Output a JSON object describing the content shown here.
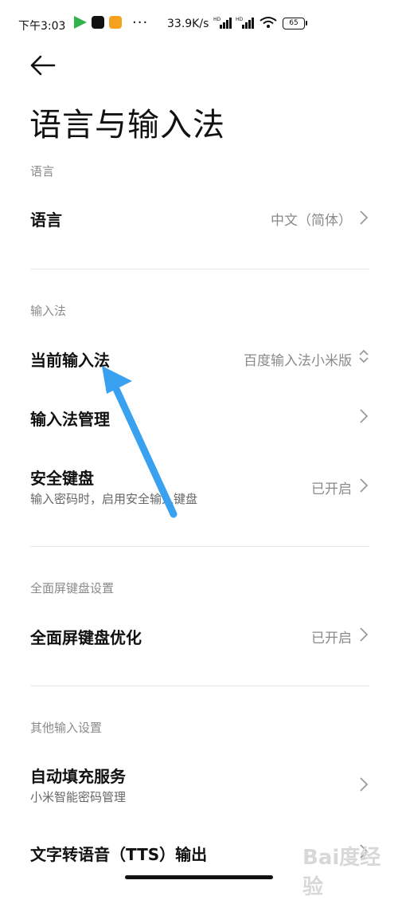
{
  "status_bar": {
    "time": "下午3:03",
    "more": "···",
    "net_speed": "33.9K/s",
    "battery": "65",
    "app_icon_colors": [
      "#2fb34a",
      "#111111",
      "#f4a11d"
    ]
  },
  "header": {
    "back_icon": "arrow-left-icon",
    "title": "语言与输入法"
  },
  "sections": {
    "language": {
      "label": "语言",
      "item_title": "语言",
      "item_value": "中文（简体）"
    },
    "input_method": {
      "label": "输入法",
      "current_title": "当前输入法",
      "current_value": "百度输入法小米版",
      "manage_title": "输入法管理",
      "secure_title": "安全键盘",
      "secure_sub": "输入密码时，启用安全输入键盘",
      "secure_value": "已开启"
    },
    "fullscreen": {
      "label": "全面屏键盘设置",
      "optimize_title": "全面屏键盘优化",
      "optimize_value": "已开启"
    },
    "other": {
      "label": "其他输入设置",
      "autofill_title": "自动填充服务",
      "autofill_sub": "小米智能密码管理",
      "tts_title": "文字转语音（TTS）输出"
    }
  },
  "colors": {
    "annotation_arrow": "#3aa0f0",
    "secondary_text": "#8a8a8a"
  },
  "watermark": "Bai度经验"
}
